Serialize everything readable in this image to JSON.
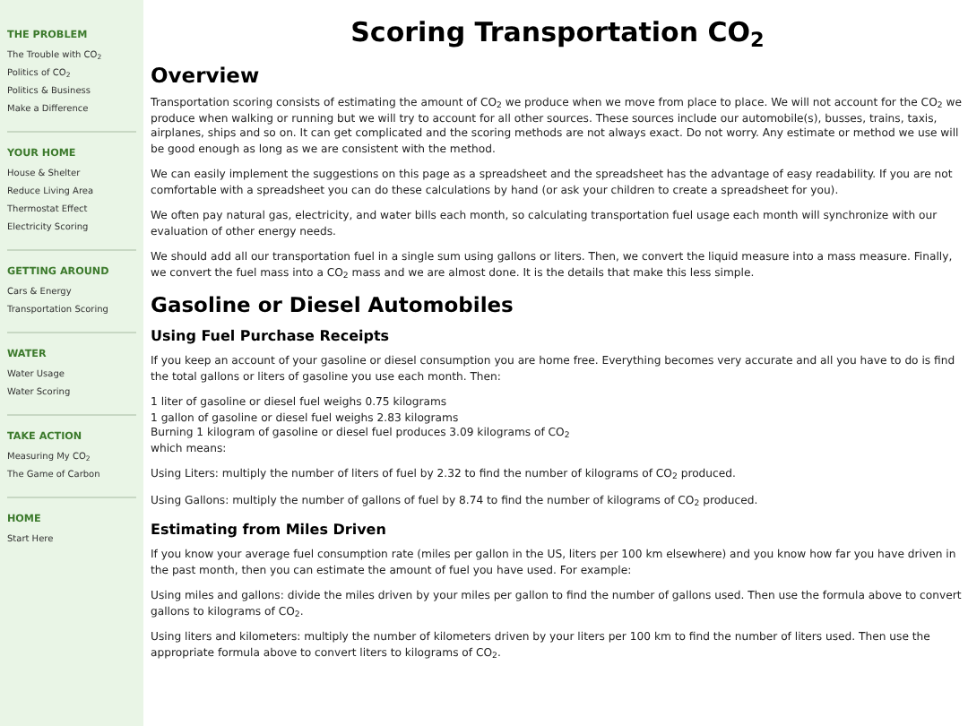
{
  "sidebar": {
    "sections": [
      {
        "heading": "THE PROBLEM",
        "links": [
          "The Trouble with CO$_{2}$",
          "Politics of CO$_{2}$",
          "Politics & Business",
          "Make a Difference"
        ]
      },
      {
        "heading": "YOUR HOME",
        "links": [
          "House & Shelter",
          "Reduce Living Area",
          "Thermostat Effect",
          "Electricity Scoring"
        ]
      },
      {
        "heading": "GETTING AROUND",
        "links": [
          "Cars & Energy",
          "Transportation Scoring"
        ]
      },
      {
        "heading": "WATER",
        "links": [
          "Water Usage",
          "Water Scoring"
        ]
      },
      {
        "heading": "TAKE ACTION",
        "links": [
          "Measuring My CO$_{2}$",
          "The Game of Carbon"
        ]
      },
      {
        "heading": "HOME",
        "links": [
          "Start Here"
        ]
      }
    ]
  },
  "content": [
    {
      "kind": "title",
      "text": "Scoring Transportation CO$_{2}$"
    },
    {
      "kind": "h2",
      "text": "Overview"
    },
    {
      "kind": "p",
      "text": "Transportation scoring consists of estimating the amount of CO$_{2}$ we produce when we move from place to place. We will not account for the CO$_{2}$ we produce when walking or running but we will try to account for all other sources. These sources include our automobile(s), busses, trains, taxis, airplanes, ships and so on. It can get complicated and the scoring methods are not always exact. Do not worry. Any estimate or method we use will be good enough as long as we are consistent with the method."
    },
    {
      "kind": "p",
      "text": "We can easily implement the suggestions on this page as a spreadsheet and the spreadsheet has the advantage of easy readability. If you are not comfortable with a spreadsheet you can do these calculations by hand (or ask your children to create a spreadsheet for you)."
    },
    {
      "kind": "p",
      "text": "We often pay natural gas, electricity, and water bills each month, so calculating transportation fuel usage each month will synchronize with our evaluation of other energy needs."
    },
    {
      "kind": "p",
      "text": "We should add all our transportation fuel in a single sum using gallons or liters. Then, we convert the liquid measure into a mass measure. Finally, we convert the fuel mass into a CO$_{2}$ mass and we are almost done. It is the details that make this less simple."
    },
    {
      "kind": "h2",
      "text": "Gasoline or Diesel Automobiles"
    },
    {
      "kind": "h3",
      "text": "Using Fuel Purchase Receipts"
    },
    {
      "kind": "p",
      "text": "If you keep an account of your gasoline or diesel consumption you are home free. Everything becomes very accurate and all you have to do is find the total gallons or liters of gasoline you use each month. Then:"
    },
    {
      "kind": "lines",
      "lines": [
        "1 liter of gasoline or diesel fuel weighs 0.75 kilograms",
        "1 gallon of gasoline or diesel fuel weighs 2.83 kilograms",
        "Burning 1 kilogram of gasoline or diesel fuel produces 3.09 kilograms of CO$_{2}$",
        "which means:"
      ]
    },
    {
      "kind": "p",
      "text": "Using Liters: multiply the number of liters of fuel by 2.32 to find the number of kilograms of CO$_{2}$ produced."
    },
    {
      "kind": "p",
      "text": "Using Gallons: multiply the number of gallons of fuel by 8.74 to find the number of kilograms of CO$_{2}$ produced."
    },
    {
      "kind": "h3",
      "text": "Estimating from Miles Driven"
    },
    {
      "kind": "p",
      "text": "If you know your average fuel consumption rate (miles per gallon in the US, liters per 100 km elsewhere) and you know how far you have driven in the past month, then you can estimate the amount of fuel you have used. For example:"
    },
    {
      "kind": "p",
      "text": "Using miles and gallons: divide the miles driven by your miles per gallon to find the number of gallons used. Then use the formula above to convert gallons to kilograms of CO$_{2}$."
    },
    {
      "kind": "p",
      "text": "Using liters and kilometers: multiply the number of kilometers driven by your liters per 100 km to find the number of liters used. Then use the appropriate formula above to convert liters to kilograms of CO$_{2}$."
    }
  ]
}
